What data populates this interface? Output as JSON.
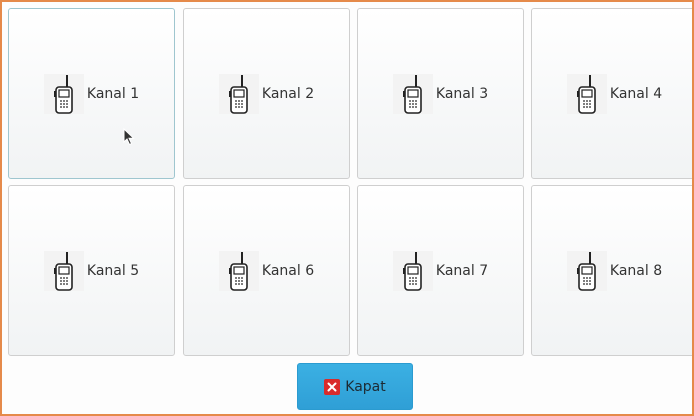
{
  "channels": [
    {
      "label": "Kanal 1",
      "icon": "walkie-talkie-icon"
    },
    {
      "label": "Kanal 2",
      "icon": "walkie-talkie-icon"
    },
    {
      "label": "Kanal 3",
      "icon": "walkie-talkie-icon"
    },
    {
      "label": "Kanal 4",
      "icon": "walkie-talkie-icon"
    },
    {
      "label": "Kanal 5",
      "icon": "walkie-talkie-icon"
    },
    {
      "label": "Kanal 6",
      "icon": "walkie-talkie-icon"
    },
    {
      "label": "Kanal 7",
      "icon": "walkie-talkie-icon"
    },
    {
      "label": "Kanal 8",
      "icon": "walkie-talkie-icon"
    }
  ],
  "close_button": {
    "label": "Kapat",
    "icon": "close-icon"
  },
  "colors": {
    "frame_border": "#e58a4a",
    "button_accent": "#3bb0e3",
    "close_icon": "#d92b2b"
  }
}
